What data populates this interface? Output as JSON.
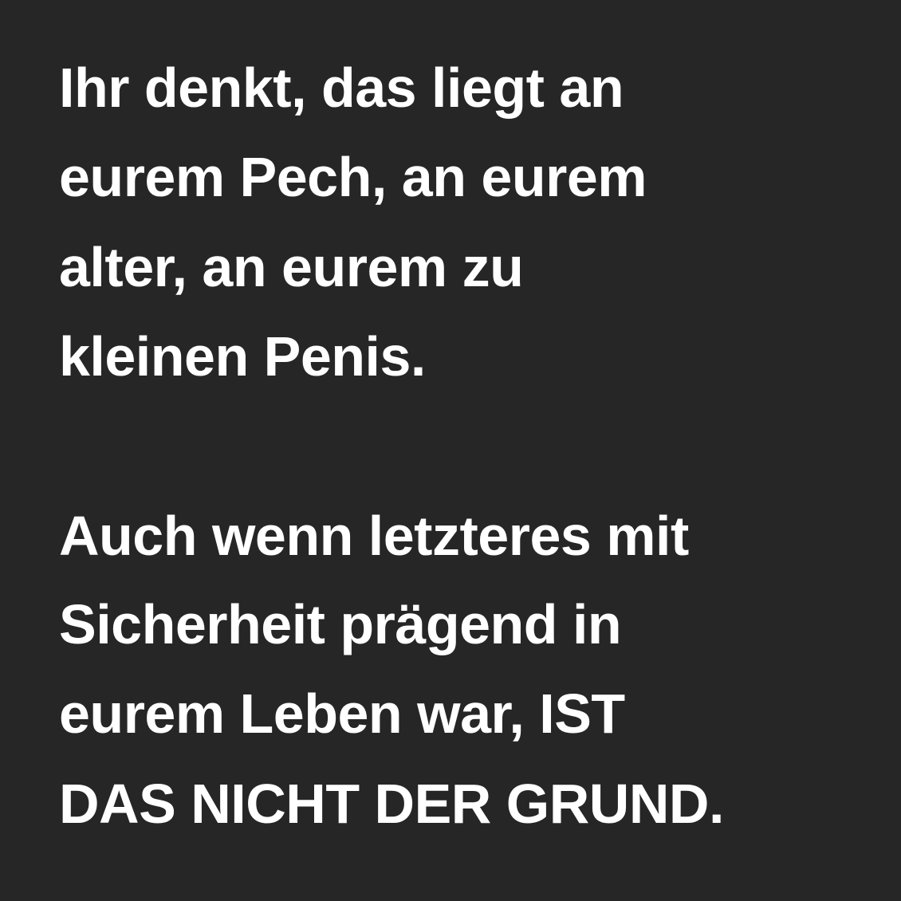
{
  "colors": {
    "background": "#262626",
    "text": "#ffffff"
  },
  "paragraphs": [
    {
      "lines": [
        "Ihr denkt, das liegt an",
        "eurem Pech, an eurem",
        "alter, an eurem zu",
        "kleinen Penis."
      ]
    },
    {
      "lines": [
        "Auch wenn letzteres mit",
        "Sicherheit prägend in",
        "eurem Leben war, IST",
        "DAS NICHT DER GRUND."
      ]
    }
  ]
}
